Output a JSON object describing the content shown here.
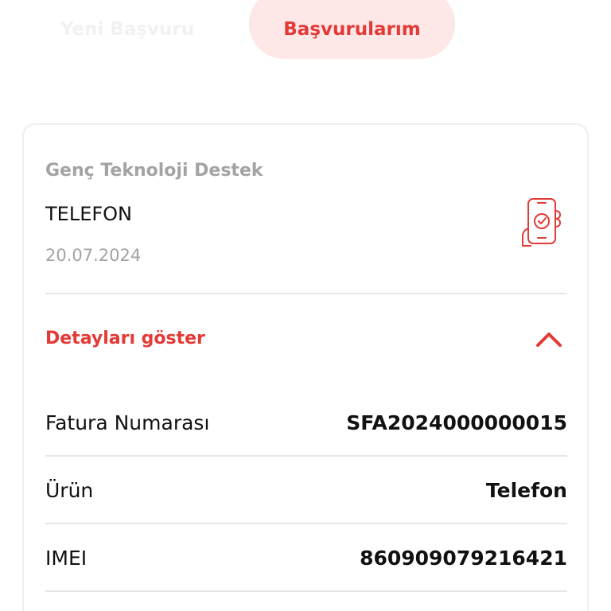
{
  "tabs": {
    "new_label": "Yeni Başvuru",
    "mine_label": "Başvurularım"
  },
  "application": {
    "program": "Genç Teknoloji Destek",
    "product_type": "TELEFON",
    "date": "20.07.2024",
    "icon": "phone-check-icon",
    "details_toggle_label": "Detayları göster",
    "details": [
      {
        "label": "Fatura Numarası",
        "value": "SFA2024000000015"
      },
      {
        "label": "Ürün",
        "value": "Telefon"
      },
      {
        "label": "IMEI",
        "value": "860909079216421"
      }
    ]
  },
  "colors": {
    "accent": "#e23a36",
    "accent_soft": "#fde7e7",
    "muted_text": "#a3a3a3",
    "divider": "#e6e6e6"
  }
}
